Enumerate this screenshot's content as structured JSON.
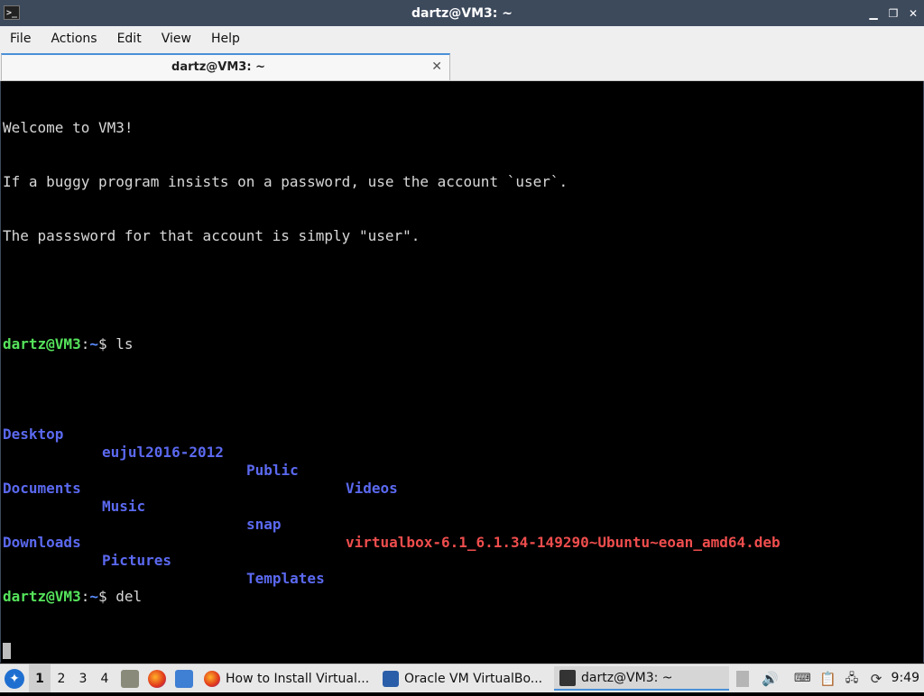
{
  "window": {
    "title": "dartz@VM3: ~",
    "app_icon_glyph": ">_",
    "controls": {
      "minimize": "▁",
      "restore": "❐",
      "close": "✕"
    }
  },
  "menu": [
    "File",
    "Actions",
    "Edit",
    "View",
    "Help"
  ],
  "tab": {
    "label": "dartz@VM3: ~",
    "close": "✕"
  },
  "terminal": {
    "welcome": [
      "Welcome to VM3!",
      "If a buggy program insists on a password, use the account `user`.",
      "The passsword for that account is simply \"user\"."
    ],
    "prompt_user": "dartz@VM3",
    "prompt_sep": ":",
    "prompt_path": "~",
    "prompt_dollar": "$ ",
    "cmd1": "ls",
    "ls_rows": [
      [
        "Desktop",
        "eujul2016-2012",
        "Public",
        "Videos"
      ],
      [
        "Documents",
        "Music",
        "snap",
        "virtualbox-6.1_6.1.34-149290~Ubuntu~eoan_amd64.deb"
      ],
      [
        "Downloads",
        "Pictures",
        "Templates",
        ""
      ]
    ],
    "cmd2": "del"
  },
  "taskbar": {
    "desktops": [
      "1",
      "2",
      "3",
      "4"
    ],
    "tasks": [
      {
        "label": "How to Install Virtual...",
        "icon": "firefox-icon"
      },
      {
        "label": "Oracle VM VirtualBo...",
        "icon": "virtualbox-icon"
      },
      {
        "label": "dartz@VM3: ~",
        "icon": "terminal-icon"
      }
    ],
    "clock": "9:49"
  },
  "colors": {
    "prompt_user": "#55e35b",
    "dir": "#5b69f0",
    "deb": "#ef4d4d",
    "titlebar": "#3d4a5c"
  }
}
